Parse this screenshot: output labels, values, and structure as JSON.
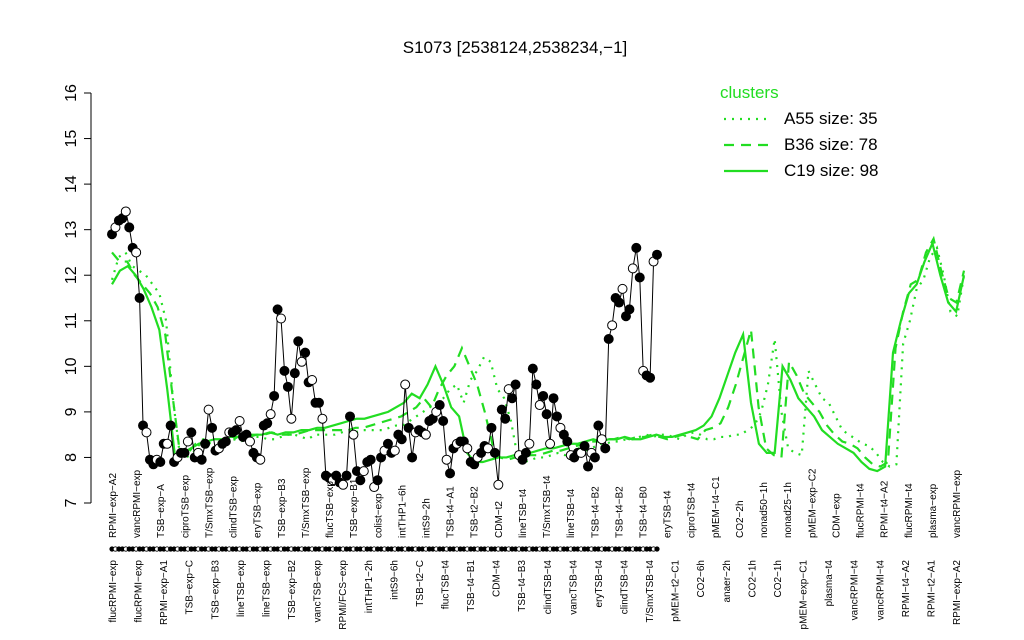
{
  "chart_data": {
    "type": "line",
    "title": "S1073 [2538124,2538234,−1]",
    "xlabel": "",
    "ylabel": "",
    "ylim": [
      7,
      16
    ],
    "yticks": [
      "7",
      "8",
      "9",
      "10",
      "11",
      "12",
      "13",
      "14",
      "15",
      "16"
    ],
    "grid": false,
    "legend": {
      "title": "clusters",
      "placement": "top-right",
      "entries": [
        {
          "label": "A55 size: 35",
          "style": "dotted"
        },
        {
          "label": "B36 size: 78",
          "style": "dashed"
        },
        {
          "label": "C19 size: 98",
          "style": "solid"
        }
      ]
    },
    "colors": {
      "clusters": "#22dd22",
      "points": "#000000"
    },
    "xtick_labels": {
      "top": [
        "RPMI−exp−A2",
        "vancRPMI−exp",
        "TSB−exp−A",
        "ciproTSB−exp",
        "T/SmxTSB−exp",
        "clindTSB−exp",
        "eryTSB−exp",
        "TSB−exp−B3",
        "T/SmxTSB−exp",
        "flucTSB−exp",
        "TSB−exp−B1",
        "colist−exp",
        "intTHP1−6h",
        "intS9−2h",
        "TSB−t4−A1",
        "TSB−t2−B2",
        "CDM−t2",
        "lineTSB−t4",
        "T/SmxTSB−t4",
        "lineTSB−t4",
        "TSB−t4−B2",
        "TSB−t4−B2",
        "TSB−t4−B0",
        "eryTSB−t4",
        "ciproTSB−t4",
        "pMEM−t4−C1",
        "CO2−2h",
        "nonad50−1h",
        "nonad25−1h",
        "pMEM−exp−C2",
        "CDM−exp",
        "flucRPMI−t4",
        "RPMI−t4−A2",
        "flucRPMI−t4",
        "plasma−exp",
        "vancRPMI−exp"
      ],
      "bottom": [
        "flucRPMI−exp",
        "flucRPMI−exp",
        "RPMI−exp−A1",
        "TSB−exp−C",
        "TSB−exp−B3",
        "lineTSB−exp",
        "lineTSB−exp",
        "TSB−exp−B2",
        "vancTSB−exp",
        "RPMI/FCS−exp",
        "intTHP1−2h",
        "intS9−6h",
        "TSB−t2−C",
        "flucTSB−t4",
        "TSB−t4−B1",
        "CDM−t4",
        "TSB−t4−B3",
        "clindTSB−t4",
        "vancTSB−t4",
        "eryTSB−t4",
        "clindTSB−t4",
        "T/SmxTSB−t4",
        "pMEM−t2−C1",
        "CO2−6h",
        "anaer−2h",
        "CO2−1h",
        "CO2−1h",
        "pMEM−exp−C1",
        "plasma−t4",
        "vancRPMI−t4",
        "vancRPMI−t4",
        "RPMI−t4−A2",
        "RPMI−t2−A1",
        "RPMI−exp−A2"
      ]
    },
    "x": [
      1,
      2,
      3,
      4,
      5,
      6,
      7,
      8,
      9,
      10,
      11,
      12,
      13,
      14,
      15,
      16,
      17,
      18,
      19,
      20,
      21,
      22,
      23,
      24,
      25,
      26,
      27,
      28,
      29,
      30,
      31,
      32,
      33,
      34,
      35,
      36,
      37,
      38,
      39,
      40,
      41,
      42,
      43,
      44,
      45,
      46,
      47,
      48,
      49,
      50,
      51,
      52,
      53,
      54,
      55,
      56,
      57,
      58,
      59,
      60,
      61,
      62,
      63,
      64,
      65,
      66,
      67,
      68,
      69,
      70,
      71,
      72,
      73,
      74,
      75,
      76,
      77,
      78,
      79,
      80,
      81,
      82,
      83,
      84,
      85,
      86,
      87,
      88,
      89,
      90,
      91,
      92,
      93,
      94,
      95,
      96,
      97,
      98,
      99,
      100,
      101,
      102,
      103,
      104,
      105,
      106,
      107,
      108,
      109,
      110,
      111,
      112,
      113,
      114,
      115,
      116,
      117,
      118,
      119,
      120,
      121,
      122,
      123,
      124,
      125,
      126,
      127,
      128,
      129,
      130,
      131,
      132,
      133,
      134,
      135,
      136,
      137,
      138,
      139,
      140,
      141,
      142,
      143,
      144,
      145,
      146,
      147,
      148,
      149,
      150,
      151,
      152,
      153,
      154,
      155,
      156,
      157,
      158,
      159,
      160,
      161,
      162,
      163,
      164,
      165,
      166,
      167,
      168,
      169,
      170,
      171,
      172,
      173,
      174,
      175,
      176,
      177,
      178,
      179,
      180,
      181,
      182,
      183,
      184,
      185,
      186,
      187,
      188,
      189,
      190,
      191,
      192,
      193,
      194,
      195,
      196,
      197,
      198,
      199,
      200,
      201,
      202,
      203,
      204,
      205,
      206,
      207,
      208,
      209,
      210,
      211,
      212,
      213,
      214,
      215,
      216,
      217,
      218,
      219,
      220,
      221,
      222,
      223,
      224,
      225,
      226,
      227,
      228,
      229,
      230,
      231,
      232,
      233,
      234,
      235,
      236,
      237,
      238,
      239,
      240,
      241,
      242,
      243,
      244,
      245,
      246,
      247,
      248
    ],
    "series": [
      {
        "name": "samples",
        "values": [
          12.9,
          13.05,
          13.2,
          13.25,
          13.4,
          13.05,
          12.6,
          12.5,
          11.5,
          8.7,
          8.55,
          7.95,
          7.85,
          7.95,
          7.9,
          8.3,
          8.3,
          8.7,
          7.9,
          8.0,
          8.1,
          8.1,
          8.35,
          8.55,
          8.0,
          8.1,
          7.95,
          8.3,
          9.05,
          8.65,
          8.15,
          8.2,
          8.3,
          8.35,
          8.55,
          8.55,
          8.6,
          8.8,
          8.45,
          8.5,
          8.35,
          8.1,
          8.0,
          7.95,
          8.7,
          8.75,
          8.95,
          9.35,
          11.25,
          11.05,
          9.9,
          9.55,
          8.85,
          9.85,
          10.55,
          10.1,
          10.3,
          9.65,
          9.7,
          9.2,
          9.2,
          8.85,
          7.6,
          7.55,
          7.5,
          7.6,
          7.45,
          7.4,
          7.6,
          8.9,
          8.5,
          7.7,
          7.5,
          7.7,
          7.9,
          7.95,
          7.35,
          7.5,
          8.0,
          8.15,
          8.3,
          8.1,
          8.15,
          8.5,
          8.4,
          9.6,
          8.65,
          8.0,
          8.55,
          8.6,
          8.55,
          8.5,
          8.8,
          8.85,
          9.0,
          9.15,
          8.8,
          7.95,
          7.65,
          8.2,
          8.3,
          8.35,
          8.35,
          8.2,
          7.9,
          7.85,
          8.0,
          8.1,
          8.25,
          8.2,
          8.65,
          8.1,
          7.4,
          9.05,
          8.85,
          9.5,
          9.3,
          9.6,
          8.05,
          7.95,
          8.1,
          8.3,
          9.95,
          9.6,
          9.15,
          9.35,
          8.95,
          8.3,
          9.3,
          8.9,
          8.65,
          8.5,
          8.35,
          8.05,
          8.0,
          8.1,
          8.1,
          8.25,
          7.8,
          8.1,
          8.0,
          8.7,
          8.4,
          8.2,
          10.6,
          10.9,
          11.5,
          11.4,
          11.7,
          11.1,
          11.25,
          12.15,
          12.6,
          11.95,
          9.9,
          9.8,
          9.75,
          12.3,
          12.45
        ]
      },
      {
        "name": "A55",
        "values": [
          11.9,
          12.4,
          12.5,
          12.2,
          12.1,
          12.0,
          11.8,
          11.6,
          11.0,
          9.3,
          8.1,
          8.0,
          8.1,
          8.3,
          8.3,
          8.2,
          8.3,
          8.35,
          8.4,
          8.35,
          8.4,
          8.45,
          8.45,
          8.4,
          8.4,
          8.45,
          8.5,
          8.5,
          8.45,
          8.4,
          8.5,
          8.5,
          8.5,
          8.5,
          8.55,
          8.6,
          8.55,
          8.6,
          8.6,
          8.6,
          8.6,
          8.65,
          8.7,
          8.7,
          8.8,
          8.9,
          9.0,
          9.1,
          9.2,
          9.3,
          9.5,
          9.6,
          9.2,
          9.7,
          9.9,
          10.2,
          10.1,
          9.5,
          9.3,
          8.8,
          8.0,
          7.9,
          7.95,
          8.0,
          8.0,
          8.05,
          8.1,
          8.05,
          8.1,
          8.2,
          8.15,
          8.2,
          8.3,
          8.3,
          8.35,
          8.35,
          8.4,
          8.4,
          8.45,
          8.5,
          8.45,
          8.5,
          8.5,
          8.45,
          8.4,
          8.5,
          8.55,
          8.5,
          8.4,
          8.4,
          8.45,
          8.45,
          8.5,
          8.5,
          8.6,
          8.7,
          9.0,
          9.6,
          10.6,
          9.0,
          8.2,
          8.1,
          8.05,
          9.9,
          9.6,
          9.3,
          9.2,
          8.9,
          8.6,
          8.5,
          8.4,
          8.3,
          8.25,
          8.1,
          7.9,
          7.8,
          7.85,
          10.5,
          11.0,
          11.7,
          11.9,
          12.4,
          12.6,
          12.0,
          11.2,
          11.1,
          12.0
        ]
      },
      {
        "name": "B36",
        "values": [
          12.5,
          12.3,
          12.3,
          12.0,
          11.8,
          11.6,
          11.3,
          10.7,
          9.3,
          8.0,
          8.1,
          8.3,
          8.4,
          8.3,
          8.3,
          8.4,
          8.4,
          8.5,
          8.45,
          8.5,
          8.5,
          8.55,
          8.5,
          8.5,
          8.5,
          8.55,
          8.6,
          8.6,
          8.6,
          8.6,
          8.6,
          8.6,
          8.65,
          8.65,
          8.7,
          8.75,
          8.8,
          8.85,
          8.9,
          9.0,
          9.1,
          9.3,
          9.1,
          9.5,
          9.8,
          10.0,
          10.4,
          10.0,
          9.6,
          9.0,
          8.3,
          8.0,
          7.95,
          8.0,
          8.0,
          8.05,
          8.05,
          8.1,
          8.15,
          8.15,
          8.2,
          8.25,
          8.3,
          8.35,
          8.35,
          8.4,
          8.4,
          8.45,
          8.4,
          8.45,
          8.45,
          8.5,
          8.45,
          8.4,
          8.45,
          8.5,
          8.45,
          8.4,
          8.6,
          8.65,
          8.75,
          9.1,
          9.6,
          10.2,
          10.8,
          9.1,
          8.2,
          8.05,
          8.0,
          10.1,
          9.8,
          9.4,
          9.2,
          9.0,
          8.7,
          8.5,
          8.35,
          8.3,
          8.2,
          8.0,
          7.85,
          7.8,
          7.9,
          10.4,
          11.2,
          11.8,
          11.9,
          12.5,
          12.8,
          12.1,
          11.5,
          11.4,
          12.1
        ]
      },
      {
        "name": "C19",
        "values": [
          11.8,
          12.1,
          12.2,
          12.0,
          11.7,
          11.3,
          10.8,
          9.5,
          8.0,
          8.1,
          8.2,
          8.3,
          8.35,
          8.4,
          8.4,
          8.45,
          8.45,
          8.5,
          8.5,
          8.5,
          8.55,
          8.5,
          8.55,
          8.55,
          8.6,
          8.6,
          8.65,
          8.65,
          8.7,
          8.75,
          8.8,
          8.85,
          8.85,
          8.9,
          8.95,
          9.0,
          9.1,
          9.2,
          9.4,
          9.3,
          9.6,
          10.0,
          9.6,
          9.1,
          8.9,
          8.1,
          7.9,
          7.9,
          7.95,
          8.0,
          8.0,
          8.05,
          8.1,
          8.1,
          8.15,
          8.2,
          8.2,
          8.25,
          8.3,
          8.3,
          8.35,
          8.4,
          8.35,
          8.4,
          8.4,
          8.45,
          8.4,
          8.4,
          8.45,
          8.5,
          8.45,
          8.45,
          8.5,
          8.55,
          8.6,
          8.7,
          8.9,
          9.3,
          9.8,
          10.3,
          10.7,
          9.2,
          8.3,
          8.1,
          8.1,
          10.0,
          9.7,
          9.3,
          9.1,
          8.9,
          8.6,
          8.45,
          8.3,
          8.2,
          8.1,
          7.9,
          7.75,
          7.7,
          7.8,
          10.3,
          11.0,
          11.6,
          11.8,
          12.3,
          12.7,
          12.0,
          11.4,
          11.2,
          12.0
        ]
      }
    ]
  }
}
